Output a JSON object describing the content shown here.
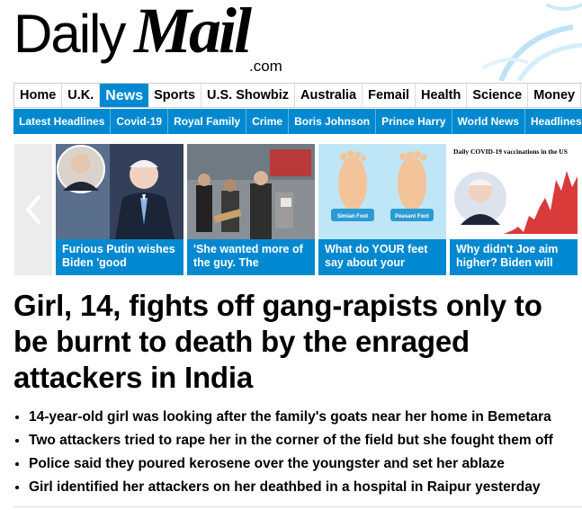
{
  "masthead": {
    "logo_daily": "Daily",
    "logo_mail": "Mail",
    "logo_com": ".com"
  },
  "primary_nav": [
    {
      "label": "Home",
      "active": false
    },
    {
      "label": "U.K.",
      "active": false
    },
    {
      "label": "News",
      "active": true
    },
    {
      "label": "Sports",
      "active": false
    },
    {
      "label": "U.S. Showbiz",
      "active": false
    },
    {
      "label": "Australia",
      "active": false
    },
    {
      "label": "Femail",
      "active": false
    },
    {
      "label": "Health",
      "active": false
    },
    {
      "label": "Science",
      "active": false
    },
    {
      "label": "Money",
      "active": false
    }
  ],
  "secondary_nav": [
    "Latest Headlines",
    "Covid-19",
    "Royal Family",
    "Crime",
    "Boris Johnson",
    "Prince Harry",
    "World News",
    "Headlines"
  ],
  "carousel": {
    "prev_icon": "chevron-left-icon",
    "cards": [
      {
        "caption": "Furious Putin wishes Biden 'good"
      },
      {
        "caption": "'She wanted more of the guy. The"
      },
      {
        "caption": "What do YOUR feet say about your",
        "label_left": "Simian Foot",
        "label_right": "Peasant Foot"
      },
      {
        "caption": "Why didn't Joe aim higher? Biden will",
        "chart_title": "Daily COVID-19 vaccinations in the US"
      }
    ]
  },
  "article": {
    "headline": "Girl, 14, fights off gang-rapists only to be burnt to death by the enraged attackers in India",
    "bullets": [
      "14-year-old girl was looking after the family's goats near her home in Bemetara",
      "Two attackers tried to rape her in the corner of the field but she fought them off",
      "Police said they poured kerosene over the youngster and set her ablaze",
      "Girl identified her attackers on her deathbed in a hospital in Raipur yesterday"
    ]
  },
  "colors": {
    "brand_blue": "#0089d0",
    "text": "#000000"
  }
}
